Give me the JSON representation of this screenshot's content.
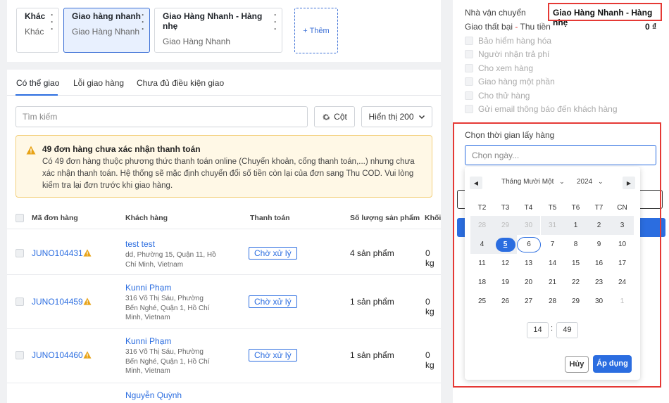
{
  "carriers": [
    {
      "name": "Khác",
      "sub": "Khác"
    },
    {
      "name": "Giao hàng nhanh",
      "sub": "Giao Hàng Nhanh"
    },
    {
      "name": "Giao Hàng Nhanh - Hàng nhẹ",
      "sub": "Giao Hàng Nhanh"
    }
  ],
  "add_label": "+ Thêm",
  "tabs": [
    "Có thể giao",
    "Lỗi giao hàng",
    "Chưa đủ điều kiện giao"
  ],
  "search": {
    "placeholder": "Tìm kiếm"
  },
  "columns_button": "Cột",
  "display_button": "Hiển thị 200",
  "warning": {
    "title": "49 đơn hàng chưa xác nhận thanh toán",
    "body": "Có 49 đơn hàng thuộc phương thức thanh toán online (Chuyển khoản, cổng thanh toán,...) nhưng chưa xác nhận thanh toán. Hệ thống sẽ mặc định chuyển đổi số tiền còn lại của đơn sang Thu COD. Vui lòng kiểm tra lại đơn trước khi giao hàng."
  },
  "table": {
    "headers": [
      "Mã đơn hàng",
      "Khách hàng",
      "Thanh toán",
      "Số lượng sản phẩm",
      "Khối"
    ],
    "rows": [
      {
        "id": "JUNO104431",
        "customer": "test test",
        "address": "dd, Phường 15, Quận 11, Hồ Chí Minh, Vietnam",
        "payment": "Chờ xử lý",
        "qty": "4 sản phẩm",
        "weight": "0 kg"
      },
      {
        "id": "JUNO104459",
        "customer": "Kunni Phạm",
        "address": "316 Võ Thị Sáu, Phường Bến Nghé, Quận 1, Hồ Chí Minh, Vietnam",
        "payment": "Chờ xử lý",
        "qty": "1 sản phẩm",
        "weight": "0 kg"
      },
      {
        "id": "JUNO104460",
        "customer": "Kunni Phạm",
        "address": "316 Võ Thị Sáu, Phường Bến Nghé, Quận 1, Hồ Chí Minh, Vietnam",
        "payment": "Chờ xử lý",
        "qty": "1 sản phẩm",
        "weight": "0 kg"
      },
      {
        "id": "",
        "customer": "Nguyễn Quỳnh",
        "address": "",
        "payment": "",
        "qty": "",
        "weight": ""
      }
    ]
  },
  "right": {
    "carrier_label": "Nhà vận chuyển",
    "carrier_value": "Giao Hàng Nhanh - Hàng nhẹ",
    "fail_label_a": "Giao thất bại",
    "fail_label_sep": " - ",
    "fail_label_b": "Thu tiền",
    "fail_value": "0 ₫",
    "options": [
      "Bảo hiểm hàng hóa",
      "Người nhận trả phí",
      "Cho xem hàng",
      "Giao hàng một phần",
      "Cho thử hàng",
      "Gửi email thông báo đến khách hàng"
    ],
    "pickup_label": "Chọn thời gian lấy hàng",
    "pickup_placeholder": "Chọn ngày..."
  },
  "datepicker": {
    "month": "Tháng Mười Một",
    "year": "2024",
    "weekdays": [
      "T2",
      "T3",
      "T4",
      "T5",
      "T6",
      "T7",
      "CN"
    ],
    "weeks": [
      [
        "28",
        "29",
        "30",
        "31",
        "1",
        "2",
        "3"
      ],
      [
        "4",
        "5",
        "6",
        "7",
        "8",
        "9",
        "10"
      ],
      [
        "11",
        "12",
        "13",
        "14",
        "15",
        "16",
        "17"
      ],
      [
        "18",
        "19",
        "20",
        "21",
        "22",
        "23",
        "24"
      ],
      [
        "25",
        "26",
        "27",
        "28",
        "29",
        "30",
        "1"
      ]
    ],
    "selected_day": "5",
    "today": "6",
    "hour": "14",
    "time_sep": ":",
    "minute": "49",
    "cancel": "Hủy",
    "apply": "Áp dụng"
  },
  "colors": {
    "accent": "#2b6de0",
    "highlight": "#e53935",
    "warning_bg": "#fff8e6",
    "warning_icon": "#e8a317"
  }
}
